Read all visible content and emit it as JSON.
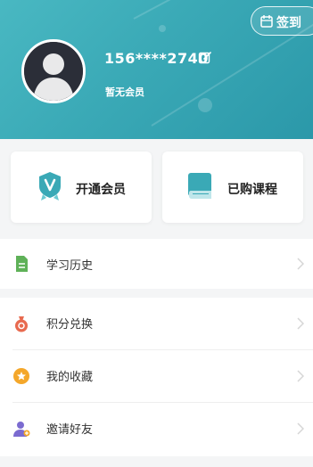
{
  "header": {
    "phone": "156****2740",
    "member_status": "暂无会员",
    "signin_label": "签到",
    "brand_color": "#3aa9b6"
  },
  "cards": [
    {
      "label": "开通会员",
      "icon": "vip-badge-icon"
    },
    {
      "label": "已购课程",
      "icon": "book-icon"
    }
  ],
  "menu": [
    {
      "label": "学习历史",
      "icon": "document-icon",
      "color": "#5fb158"
    },
    {
      "label": "积分兑换",
      "icon": "points-bag-icon",
      "color": "#e86a4f"
    },
    {
      "label": "我的收藏",
      "icon": "star-icon",
      "color": "#f4a72a"
    },
    {
      "label": "邀请好友",
      "icon": "invite-friend-icon",
      "color": "#7b6bd0"
    }
  ]
}
